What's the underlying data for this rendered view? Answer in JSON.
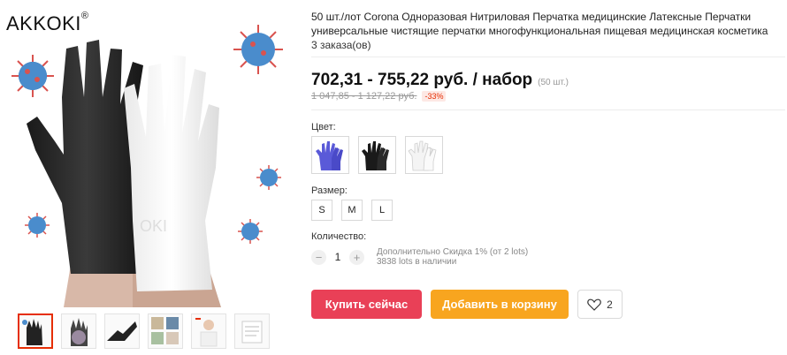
{
  "brand": {
    "name": "AKKOKI",
    "mark": "®"
  },
  "product": {
    "title": "50 шт./лот Corona Одноразовая Нитриловая Перчатка медицинские Латексные Перчатки универсальные чистящие перчатки многофункциональная пищевая медицинская косметика",
    "orders": "3 заказа(ов)",
    "price": "702,31 - 755,22 руб. / набор",
    "price_unit_note": "(50 шт.)",
    "old_price": "1 047,85 - 1 127,22 руб.",
    "discount": "-33%"
  },
  "color": {
    "label": "Цвет:",
    "options": [
      "blue-glove",
      "black-glove",
      "white-glove"
    ]
  },
  "size": {
    "label": "Размер:",
    "options": [
      "S",
      "M",
      "L"
    ]
  },
  "quantity": {
    "label": "Количество:",
    "minus": "−",
    "plus": "+",
    "value": "1",
    "discount_note": "Дополнительно Скидка 1% (от 2 lots)",
    "stock_note": "3838 lots в наличии"
  },
  "actions": {
    "buy_now": "Купить сейчас",
    "add_to_cart": "Добавить в корзину",
    "wishlist_count": "2"
  },
  "colors_theme": {
    "buy": "#e94057",
    "cart": "#f8a51f",
    "discount": "#e62e04"
  }
}
